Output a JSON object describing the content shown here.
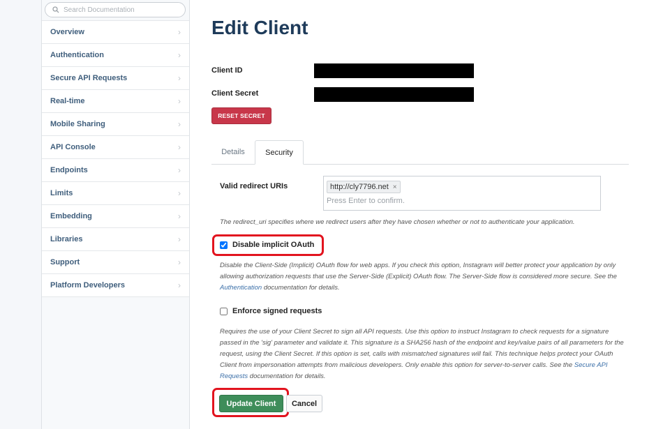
{
  "search": {
    "placeholder": "Search Documentation",
    "icon": "search-icon"
  },
  "sidebar": {
    "items": [
      {
        "label": "Overview"
      },
      {
        "label": "Authentication"
      },
      {
        "label": "Secure API Requests"
      },
      {
        "label": "Real-time"
      },
      {
        "label": "Mobile Sharing"
      },
      {
        "label": "API Console"
      },
      {
        "label": "Endpoints"
      },
      {
        "label": "Limits"
      },
      {
        "label": "Embedding"
      },
      {
        "label": "Libraries"
      },
      {
        "label": "Support"
      },
      {
        "label": "Platform Developers"
      }
    ],
    "chevron": "›"
  },
  "page": {
    "title": "Edit Client",
    "client_id_label": "Client ID",
    "client_secret_label": "Client Secret",
    "reset_secret_label": "RESET SECRET"
  },
  "tabs": [
    {
      "label": "Details",
      "active": false
    },
    {
      "label": "Security",
      "active": true
    }
  ],
  "security": {
    "redirect_label": "Valid redirect URIs",
    "redirect_tag": "http://cly7796.net",
    "redirect_tag_remove": "×",
    "redirect_placeholder": "Press Enter to confirm.",
    "redirect_help": "The redirect_uri specifies where we redirect users after they have chosen whether or not to authenticate your application.",
    "implicit_label": "Disable implicit OAuth",
    "implicit_checked": true,
    "implicit_help_pre": "Disable the Client-Side (Implicit) OAuth flow for web apps. If you check this option, Instagram will better protect your application by only allowing authorization requests that use the Server-Side (Explicit) OAuth flow. The Server-Side flow is considered more secure. See the ",
    "implicit_help_link": "Authentication",
    "implicit_help_post": " documentation for details.",
    "signed_label": "Enforce signed requests",
    "signed_checked": false,
    "signed_help_pre": "Requires the use of your Client Secret to sign all API requests. Use this option to instruct Instagram to check requests for a signature passed in the 'sig' parameter and validate it. This signature is a SHA256 hash of the endpoint and key/value pairs of all parameters for the request, using the Client Secret. If this option is set, calls with mismatched signatures will fail. This technique helps protect your OAuth Client from impersonation attempts from malicious developers. Only enable this option for server-to-server calls. See the ",
    "signed_help_link": "Secure API Requests",
    "signed_help_post": " documentation for details."
  },
  "actions": {
    "update_label": "Update Client",
    "cancel_label": "Cancel"
  },
  "colors": {
    "title": "#1e3b5a",
    "nav_text": "#3f5e7c",
    "reset_button": "#c8374a",
    "update_button": "#3e8d5a",
    "highlight": "#e2141f",
    "link": "#3b6fa8"
  }
}
